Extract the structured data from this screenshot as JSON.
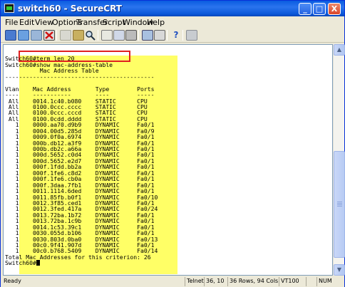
{
  "window": {
    "title": "switch60 - SecureCRT"
  },
  "titlebar_buttons": {
    "minimize": "_",
    "maximize": "□",
    "close": "X"
  },
  "menu": [
    "File",
    "Edit",
    "View",
    "Options",
    "Transfer",
    "Script",
    "Window",
    "Help"
  ],
  "toolbar": {
    "icons": [
      "connect-icon",
      "quick-connect-icon",
      "reconnect-icon",
      "disconnect-icon",
      "copy-icon",
      "paste-icon",
      "find-icon",
      "print-icon",
      "print-setup-icon",
      "printer-icon",
      "session-options-icon",
      "global-options-icon",
      "help-icon",
      "about-icon"
    ]
  },
  "terminal": {
    "lines": [
      "",
      "Switch60#term len 20",
      "Switch60#show mac-address-table",
      "          Mac Address Table",
      "-------------------------------------------",
      "",
      "Vlan    Mac Address       Type        Ports",
      "----    -----------       ----        -----",
      " All    0014.1c40.b080    STATIC      CPU",
      " All    0100.0ccc.cccc    STATIC      CPU",
      " All    0100.0ccc.cccd    STATIC      CPU",
      " All    0100.0cdd.dddd    STATIC      CPU",
      "   1    0000.aa70.d9b9    DYNAMIC     Fa0/1",
      "   1    0004.00d5.285d    DYNAMIC     Fa0/9",
      "   1    0009.0f0a.6974    DYNAMIC     Fa0/1",
      "   1    000b.db12.a3f9    DYNAMIC     Fa0/1",
      "   1    000b.db2c.a66a    DYNAMIC     Fa0/1",
      "   1    000d.5652.c0d4    DYNAMIC     Fa0/1",
      "   1    000d.5652.e2d7    DYNAMIC     Fa0/1",
      "   1    000f.1fdd.bb2a    DYNAMIC     Fa0/1",
      "   1    000f.1fe6.c8d2    DYNAMIC     Fa0/1",
      "   1    000f.1fe6.cb0a    DYNAMIC     Fa0/1",
      "   1    000f.3daa.7fb1    DYNAMIC     Fa0/1",
      "   1    0011.1114.6ded    DYNAMIC     Fa0/1",
      "   1    0011.85fb.b0f1    DYNAMIC     Fa0/10",
      "   1    0012.3f85.ced1    DYNAMIC     Fa0/1",
      "   1    0012.3fed.417a    DYNAMIC     Fa0/24",
      "   1    0013.72ba.1b72    DYNAMIC     Fa0/1",
      "   1    0013.72ba.1c9b    DYNAMIC     Fa0/1",
      "   1    0014.1c53.39c1    DYNAMIC     Fa0/1",
      "   1    0030.055d.b106    DYNAMIC     Fa0/1",
      "   1    0030.803d.0ba0    DYNAMIC     Fa0/13",
      "   1    00c0.9f41.907d    DYNAMIC     Fa0/1",
      "   1    00c0.b768.5409    DYNAMIC     Fa0/14",
      "Total Mac Addresses for this criterion: 26"
    ],
    "prompt": "Switch60#"
  },
  "statusbar": {
    "ready": "Ready",
    "protocol": "Telnet",
    "position": "36, 10",
    "size": "36 Rows, 94 Cols",
    "emulation": "VT100",
    "blank": "",
    "numlock": "NUM"
  }
}
